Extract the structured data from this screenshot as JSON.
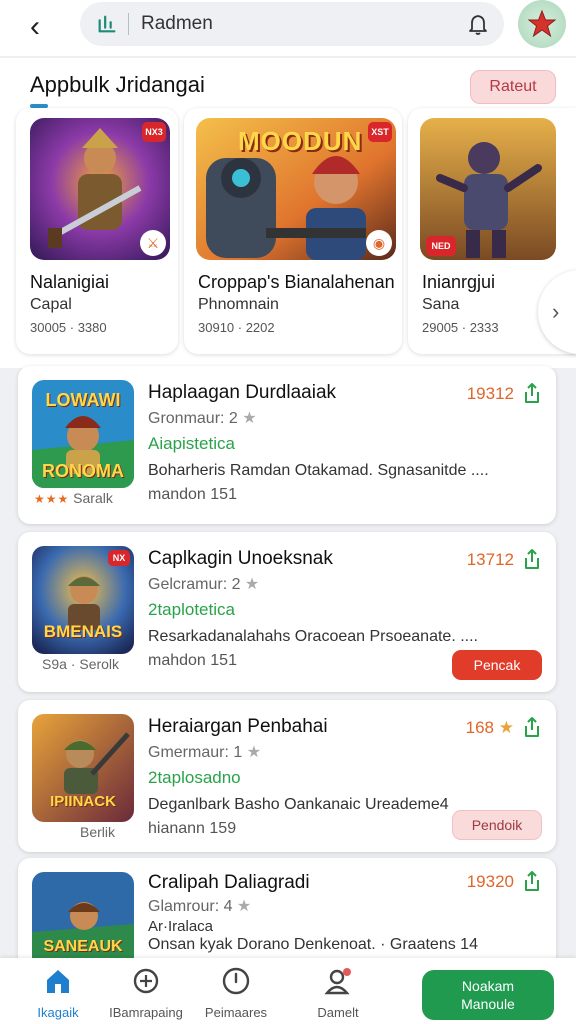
{
  "search": {
    "query": "Radmen"
  },
  "section": {
    "title": "Appbulk Jridangai",
    "action_label": "Rateut"
  },
  "featured": [
    {
      "title": "Nalanigiai",
      "subtitle": "Capal",
      "meta": "30005 · 3380",
      "badge": "NX3"
    },
    {
      "title": "Croppap's Bianalahenan",
      "subtitle": "Phnomnain",
      "meta": "30910 · 2202",
      "badge": "XST",
      "art_text": "MOODUN"
    },
    {
      "title": "Inianrgjui",
      "subtitle": "Sana",
      "meta": "29005 · 2333",
      "badge": "NED"
    }
  ],
  "apps": [
    {
      "title": "Haplaagan Durdlaaiak",
      "developer": "Gronmaur",
      "rating": "2",
      "category": "Aiapistetica",
      "description": "Boharheris Ramdan Otakamad. Sgnasanitde ....",
      "size": "mandon 151",
      "price": "19312",
      "thumb_text_top": "LOWAWI",
      "thumb_text_bottom": "RONOMA",
      "below_thumb": "Saralk",
      "button": ""
    },
    {
      "title": "Caplkagin Unoeksnak",
      "developer": "Gelcramur",
      "rating": "2",
      "category": "2taplotetica",
      "description": "Resarkadanalahahs Oracoean Prsoeanate. ....",
      "size": "mahdon 151",
      "price": "13712",
      "thumb_text_top": "",
      "thumb_text_bottom": "BMENAIS",
      "below_thumb": "S9a · Serolk",
      "button": "Pencak"
    },
    {
      "title": "Heraiargan Penbahai",
      "developer": "Gmermaur",
      "rating": "1",
      "category": "2taplosadno",
      "description": "Deganlbark Basho Oankanaic Ureademe4",
      "size": "hianann 159",
      "price": "168",
      "thumb_text_top": "",
      "thumb_text_bottom": "IPIINACK",
      "below_thumb": "Berlik",
      "button": "Pendoik"
    },
    {
      "title": "Cralipah Daliagradi",
      "developer": "Glamrour",
      "rating": "4",
      "category": "Ar·Iralaca",
      "description": "Onsan kyak Dorano Denkenoat. · Graatens 14",
      "size": "",
      "price": "19320",
      "thumb_text_top": "",
      "thumb_text_bottom": "SANEAUK",
      "below_thumb": "",
      "button": ""
    }
  ],
  "nav": {
    "items": [
      {
        "label": "Ikagaik"
      },
      {
        "label": "IBamrapaing"
      },
      {
        "label": "Peimaares"
      },
      {
        "label": "Damelt"
      }
    ],
    "cta_line1": "Noakam",
    "cta_line2": "Manoule"
  },
  "colors": {
    "accent": "#e0662a",
    "green": "#2aa24a",
    "primary": "#1f9a4f",
    "nav_active": "#1e7fcf"
  }
}
